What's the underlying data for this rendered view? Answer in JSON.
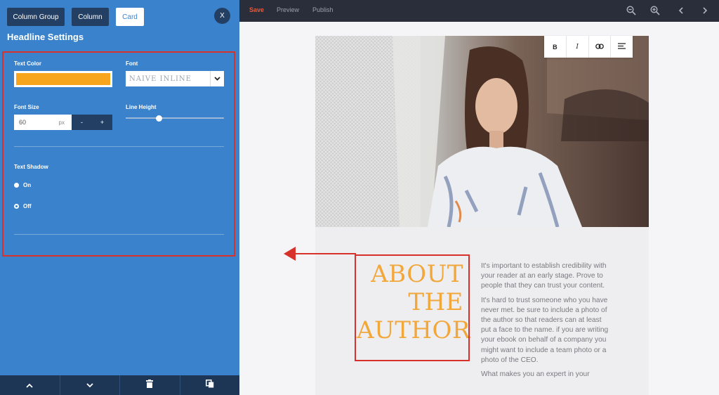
{
  "panel": {
    "tabs": [
      "Column Group",
      "Column",
      "Card"
    ],
    "active_tab": "Card",
    "close_label": "X",
    "title": "Headline Settings",
    "text_color": {
      "label": "Text Color",
      "value": "#f7a51c"
    },
    "font": {
      "label": "Font",
      "value": "NAIVE INLINE"
    },
    "font_size": {
      "label": "Font Size",
      "value": "60",
      "unit": "px",
      "decrement": "-",
      "increment": "+"
    },
    "line_height": {
      "label": "Line Height",
      "value_fraction": 0.34
    },
    "text_shadow": {
      "label": "Text Shadow",
      "options": [
        {
          "label": "On",
          "checked": false
        },
        {
          "label": "Off",
          "checked": true
        }
      ]
    },
    "footer": {
      "icons": [
        "chevron-up-icon",
        "chevron-down-icon",
        "trash-icon",
        "copy-icon"
      ]
    }
  },
  "topbar": {
    "save": "Save",
    "preview": "Preview",
    "publish": "Publish",
    "icons": [
      "zoom-out-icon",
      "zoom-in-icon",
      "chevron-left-icon",
      "chevron-right-icon"
    ]
  },
  "format_toolbar": {
    "bold": "B",
    "italic": "I",
    "icons": [
      "link-icon",
      "align-left-icon"
    ]
  },
  "content": {
    "headline": [
      "ABOUT",
      "THE",
      "AUTHOR"
    ],
    "paragraphs": [
      "It's important to establish credibility with your reader at an early stage. Prove to people that they can trust your content.",
      "It's hard to trust someone who you have never met. be sure to include a photo of the author so that readers can at least put a face to the name. if you are writing your ebook on behalf of a company you might want to include a team photo or a photo of the CEO.",
      "What makes you an expert in your"
    ]
  },
  "colors": {
    "panel_bg": "#3a83cc",
    "dark_button": "#233f63",
    "accent_orange": "#f2a73b",
    "highlight_red": "#d8302a"
  }
}
